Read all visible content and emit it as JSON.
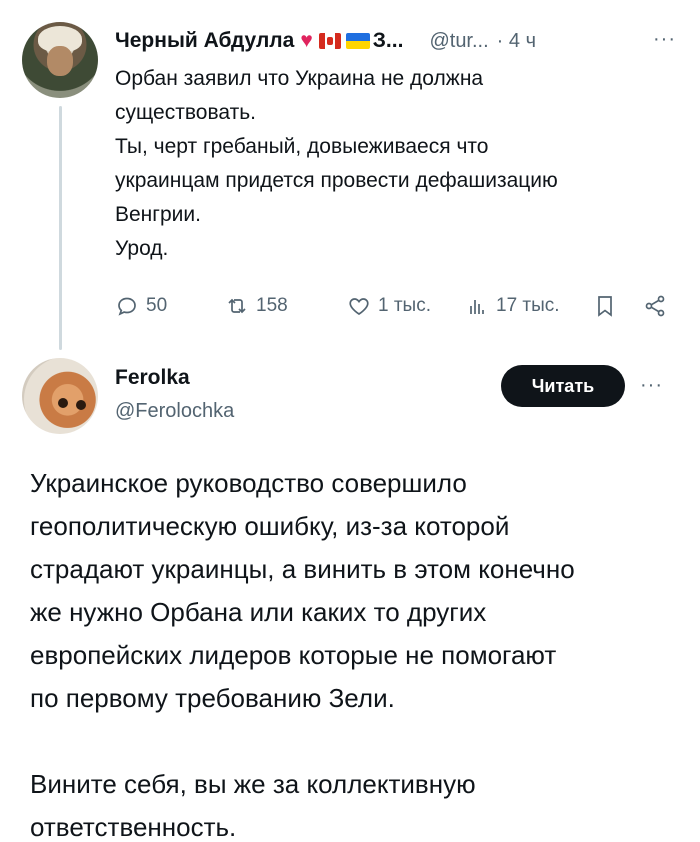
{
  "tweet1": {
    "author_name": "Черный Абдулла",
    "name_tail": "З...",
    "handle": "@tur...",
    "time": "· 4 ч",
    "more": "···",
    "text_lines": [
      "Орбан заявил что Украина не должна",
      "существовать.",
      "Ты, черт гребаный, довыеживаеся что",
      "украинцам придется провести дефашизацию",
      "Венгрии.",
      "Урод."
    ],
    "actions": {
      "replies": "50",
      "retweets": "158",
      "likes": "1 тыс.",
      "views": "17 тыс."
    },
    "icons": [
      "heart-emoji",
      "canada-flag",
      "ukraine-flag",
      "reply-icon",
      "retweet-icon",
      "like-icon",
      "views-icon",
      "bookmark-icon",
      "share-icon"
    ],
    "colors": {
      "heart": "#e0245e",
      "secondary": "#536471"
    }
  },
  "tweet2": {
    "author_name": "Ferolka",
    "handle": "@Ferolochka",
    "follow_label": "Читать",
    "more": "···",
    "paragraph1": [
      "Украинское руководство совершило",
      "геополитическую ошибку, из-за которой",
      "страдают украинцы, а винить в этом конечно",
      "же нужно Орбана или каких то других",
      "европейских лидеров которые не помогают",
      "по первому требованию Зели."
    ],
    "paragraph2": [
      "Вините себя, вы же за коллективную",
      "ответственность."
    ]
  }
}
